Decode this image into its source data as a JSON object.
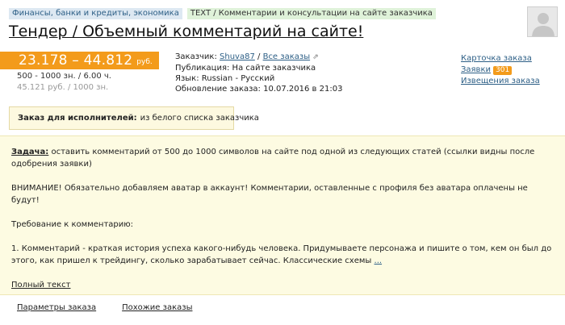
{
  "tags": {
    "category": "Финансы, банки и кредиты, экономика",
    "type": "TEXT / Комментарии и консультации на сайте заказчика"
  },
  "title": "Тендер / Объемный комментарий на сайте!",
  "price": {
    "range": "23.178 – 44.812",
    "unit": "руб.",
    "volume": "500 - 1000 зн. / 6.00 ч.",
    "rate": "45.121 руб. / 1000 зн."
  },
  "info": {
    "customer_label": "Заказчик:",
    "customer_name": "Shuva87",
    "separator": "/",
    "all_orders": "Все заказы",
    "publication_label": "Публикация:",
    "publication_value": "На сайте заказчика",
    "language_label": "Язык:",
    "language_value": "Russian - Русский",
    "updated_label": "Обновление заказа:",
    "updated_value": "10.07.2016 в 21:03"
  },
  "links": {
    "card": "Карточка заказа",
    "applications": "Заявки",
    "applications_count": "301",
    "notifications": "Извещения заказа"
  },
  "notice": {
    "label": "Заказ для исполнителей:",
    "value": "из белого списка заказчика"
  },
  "task": {
    "head": "Задача:",
    "line1": "оставить комментарий от 500 до 1000 символов на сайте под одной из следующих статей (ссылки видны после одобрения заявки)",
    "p2": "ВНИМАНИЕ! Обязательно добавляем аватар в аккаунт! Комментарии, оставленные с профиля без аватара оплачены не будут!",
    "p3": "Требование к комментарию:",
    "p4": "1. Комментарий - краткая история успеха какого-нибудь человека. Придумываете персонажа и пишите о том, кем он был до этого, как пришел к трейдингу, сколько зарабатывает сейчас. Классические схемы",
    "more": "...",
    "full_text": "Полный текст"
  },
  "bottom": {
    "params": "Параметры заказа",
    "similar": "Похожие заказы"
  }
}
